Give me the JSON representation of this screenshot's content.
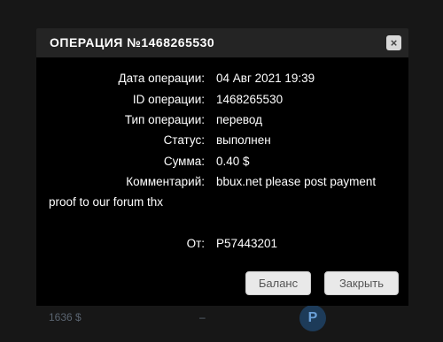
{
  "background": {
    "bottom_left_text": "1636 $",
    "dash": "–",
    "circle_letter": "P"
  },
  "modal": {
    "title": "ОПЕРАЦИЯ №1468265530",
    "close_icon": "×",
    "fields": [
      {
        "label": "Дата операции:",
        "value": "04 Авг 2021 19:39"
      },
      {
        "label": "ID операции:",
        "value": "1468265530"
      },
      {
        "label": "Тип операции:",
        "value": "перевод"
      },
      {
        "label": "Статус:",
        "value": "выполнен"
      },
      {
        "label": "Сумма:",
        "value": "0.40 $"
      },
      {
        "label": "Комментарий:",
        "value": "bbux.net please post payment"
      }
    ],
    "comment_continuation": "proof to our forum thx",
    "from_label": "От:",
    "from_value": "P57443201",
    "buttons": {
      "balance": "Баланс",
      "close": "Закрыть"
    }
  },
  "colors": {
    "modal_header": "#242424",
    "modal_body": "#000000",
    "button_bg": "#e9e9e9"
  }
}
